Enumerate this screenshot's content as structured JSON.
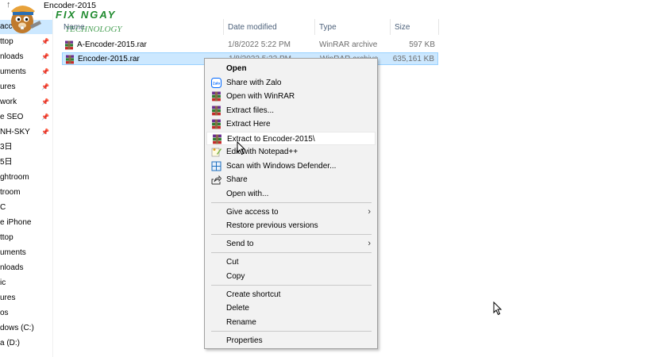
{
  "window": {
    "path": "Encoder-2015",
    "up_arrow": "↑"
  },
  "logo": {
    "line1": "FIX NGAY",
    "line2": "TECHNOLOGY"
  },
  "nav": {
    "items": [
      {
        "label": "acc",
        "pinned": false,
        "selected": true
      },
      {
        "label": "ttop",
        "pinned": true
      },
      {
        "label": "nloads",
        "pinned": true
      },
      {
        "label": "uments",
        "pinned": true
      },
      {
        "label": "ures",
        "pinned": true
      },
      {
        "label": "work",
        "pinned": true
      },
      {
        "label": "e SEO",
        "pinned": true
      },
      {
        "label": "NH-SKY",
        "pinned": true
      },
      {
        "label": "3日",
        "pinned": false
      },
      {
        "label": "5日",
        "pinned": false
      },
      {
        "label": "ghtroom",
        "pinned": false
      },
      {
        "label": "troom",
        "pinned": false
      },
      {
        "label": "C",
        "pinned": false
      },
      {
        "label": "e iPhone",
        "pinned": false
      },
      {
        "label": "ttop",
        "pinned": false
      },
      {
        "label": "uments",
        "pinned": false
      },
      {
        "label": "nloads",
        "pinned": false
      },
      {
        "label": "ic",
        "pinned": false
      },
      {
        "label": "ures",
        "pinned": false
      },
      {
        "label": "os",
        "pinned": false
      },
      {
        "label": "dows (C:)",
        "pinned": false
      },
      {
        "label": "a (D:)",
        "pinned": false
      }
    ]
  },
  "columns": {
    "name": "Name",
    "date": "Date modified",
    "type": "Type",
    "size": "Size"
  },
  "files": [
    {
      "name": "A-Encoder-2015.rar",
      "date": "1/8/2022 5:22 PM",
      "type": "WinRAR archive",
      "size": "597 KB",
      "selected": false
    },
    {
      "name": "Encoder-2015.rar",
      "date": "1/8/2022 5:22 PM",
      "type": "WinRAR archive",
      "size": "635,161 KB",
      "selected": true
    }
  ],
  "context_menu": {
    "groups": [
      [
        {
          "label": "Open",
          "icon": "none",
          "bold": true
        },
        {
          "label": "Share with Zalo",
          "icon": "zalo-icon"
        },
        {
          "label": "Open with WinRAR",
          "icon": "winrar-icon"
        },
        {
          "label": "Extract files...",
          "icon": "winrar-icon"
        },
        {
          "label": "Extract Here",
          "icon": "winrar-icon"
        },
        {
          "label": "Extract to Encoder-2015\\",
          "icon": "winrar-icon",
          "hover": true
        },
        {
          "label": "Edit with Notepad++",
          "icon": "notepadpp-icon"
        },
        {
          "label": "Scan with Windows Defender...",
          "icon": "defender-icon"
        },
        {
          "label": "Share",
          "icon": "share-icon"
        },
        {
          "label": "Open with...",
          "icon": "none"
        }
      ],
      [
        {
          "label": "Give access to",
          "icon": "none",
          "submenu": true
        },
        {
          "label": "Restore previous versions",
          "icon": "none"
        }
      ],
      [
        {
          "label": "Send to",
          "icon": "none",
          "submenu": true
        }
      ],
      [
        {
          "label": "Cut",
          "icon": "none"
        },
        {
          "label": "Copy",
          "icon": "none"
        }
      ],
      [
        {
          "label": "Create shortcut",
          "icon": "none"
        },
        {
          "label": "Delete",
          "icon": "none"
        },
        {
          "label": "Rename",
          "icon": "none"
        }
      ],
      [
        {
          "label": "Properties",
          "icon": "none"
        }
      ]
    ]
  },
  "colors": {
    "selection": "#cce8ff",
    "selection_border": "#99d1ff",
    "menu_bg": "#f2f2f2",
    "logo_green": "#1f8a2e"
  }
}
